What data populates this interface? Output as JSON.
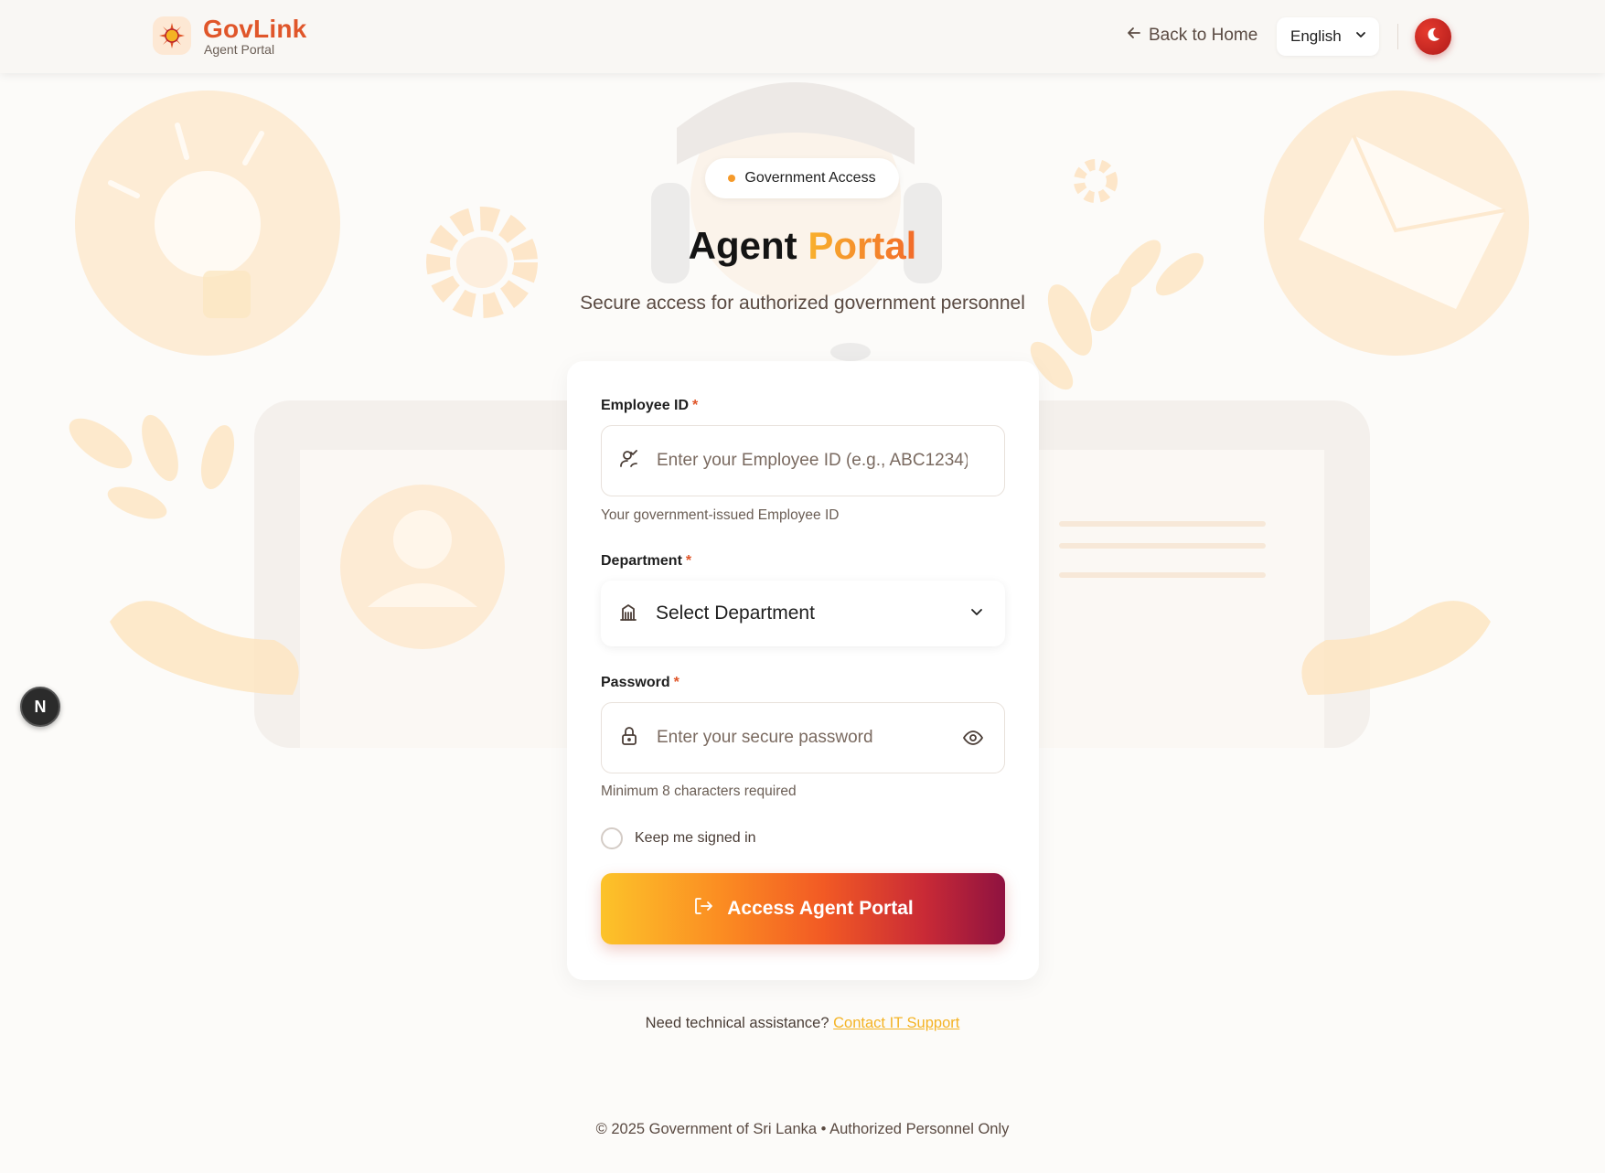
{
  "header": {
    "brand": "GovLink",
    "brand_sub": "Agent Portal",
    "back_link": "Back to Home",
    "language": "English",
    "icons": {
      "logo": "sun-emblem-icon",
      "back": "arrow-left-icon",
      "language": "chevron-down-icon",
      "theme": "moon-icon"
    }
  },
  "hero": {
    "badge": "Government Access",
    "title_main": "Agent",
    "title_accent": "Portal",
    "subtitle": "Secure access for authorized government personnel"
  },
  "form": {
    "employee_id": {
      "label": "Employee ID",
      "required_mark": "*",
      "placeholder": "Enter your Employee ID (e.g., ABC1234)",
      "value": "",
      "helper": "Your government-issued Employee ID",
      "icon": "user-check-icon"
    },
    "department": {
      "label": "Department",
      "required_mark": "*",
      "selected": "Select Department",
      "icon": "building-icon"
    },
    "password": {
      "label": "Password",
      "required_mark": "*",
      "placeholder": "Enter your secure password",
      "value": "",
      "helper": "Minimum 8 characters required",
      "icon": "lock-icon",
      "toggle_icon": "eye-icon"
    },
    "remember": {
      "label": "Keep me signed in",
      "checked": false
    },
    "submit": {
      "label": "Access Agent Portal",
      "icon": "log-in-icon"
    }
  },
  "assist": {
    "text": "Need technical assistance?",
    "link": "Contact IT Support"
  },
  "footer": {
    "text": "© 2025 Government of Sri Lanka • Authorized Personnel Only"
  },
  "dev_badge": {
    "label": "N"
  },
  "colors": {
    "brand_orange": "#e0562a",
    "accent_yellow": "#f4b324",
    "button_gradient_start": "#fcc32a",
    "button_gradient_end": "#8f1240",
    "theme_toggle": "#c92a2a"
  }
}
